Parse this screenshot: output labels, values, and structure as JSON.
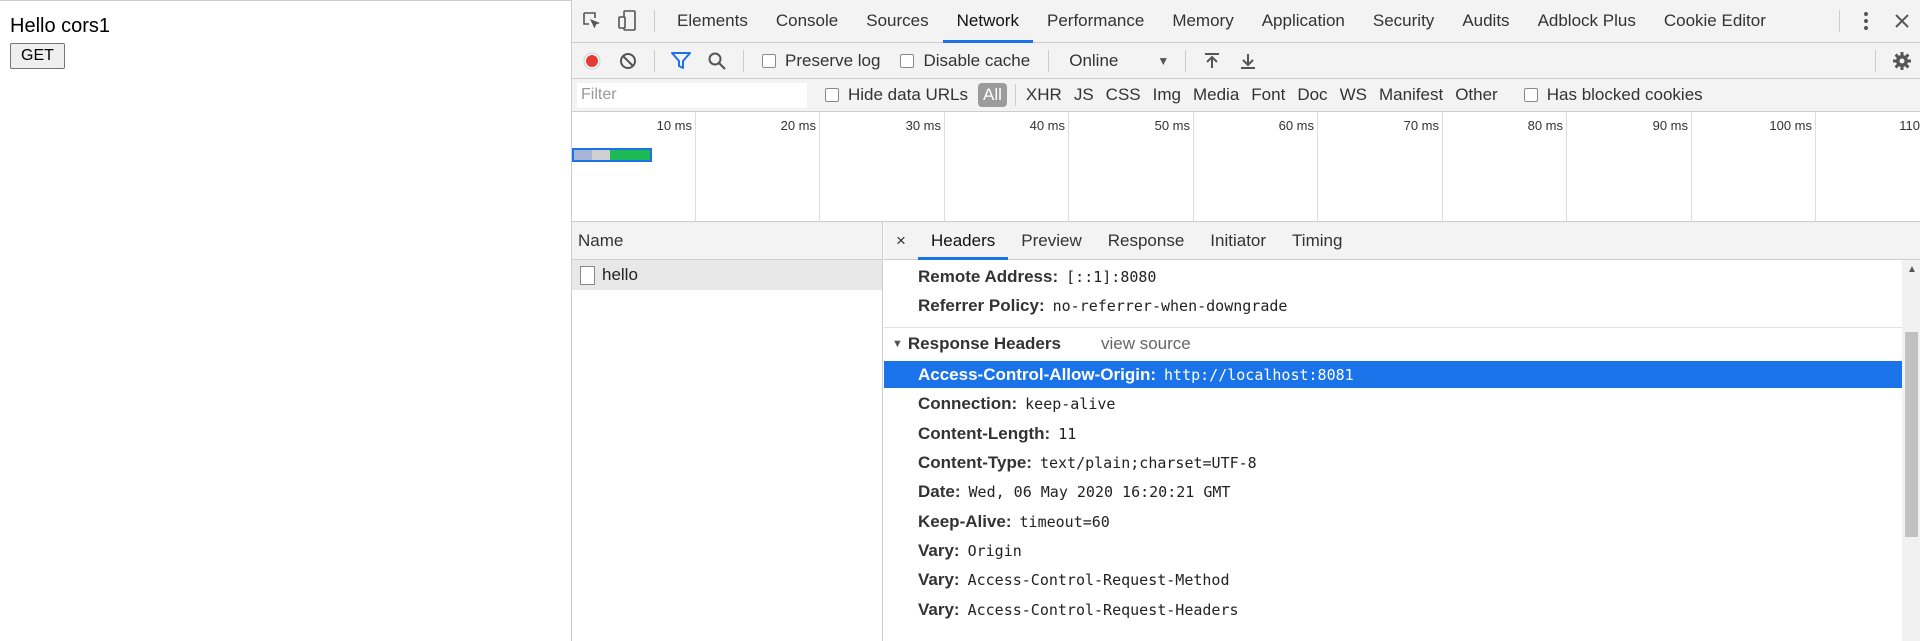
{
  "page": {
    "heading": "Hello cors1",
    "get_button": "GET"
  },
  "devtools": {
    "tabs": [
      "Elements",
      "Console",
      "Sources",
      "Network",
      "Performance",
      "Memory",
      "Application",
      "Security",
      "Audits",
      "Adblock Plus",
      "Cookie Editor"
    ],
    "active_tab": "Network",
    "toolbar": {
      "preserve_log": "Preserve log",
      "disable_cache": "Disable cache",
      "throttle": "Online"
    },
    "filter": {
      "placeholder": "Filter",
      "hide_data_urls": "Hide data URLs",
      "types": [
        "All",
        "XHR",
        "JS",
        "CSS",
        "Img",
        "Media",
        "Font",
        "Doc",
        "WS",
        "Manifest",
        "Other"
      ],
      "active_type": "All",
      "has_blocked_cookies": "Has blocked cookies"
    },
    "timeline": {
      "ticks": [
        "10 ms",
        "20 ms",
        "30 ms",
        "40 ms",
        "50 ms",
        "60 ms",
        "70 ms",
        "80 ms",
        "90 ms",
        "100 ms",
        "110"
      ]
    },
    "requests": {
      "column": "Name",
      "items": [
        "hello"
      ]
    },
    "detail": {
      "close": "×",
      "tabs": [
        "Headers",
        "Preview",
        "Response",
        "Initiator",
        "Timing"
      ],
      "active_tab": "Headers",
      "general": [
        {
          "key": "Remote Address:",
          "value": "[::1]:8080"
        },
        {
          "key": "Referrer Policy:",
          "value": "no-referrer-when-downgrade"
        }
      ],
      "response_headers_title": "Response Headers",
      "view_source": "view source",
      "response_headers": [
        {
          "key": "Access-Control-Allow-Origin:",
          "value": "http://localhost:8081"
        },
        {
          "key": "Connection:",
          "value": "keep-alive"
        },
        {
          "key": "Content-Length:",
          "value": "11"
        },
        {
          "key": "Content-Type:",
          "value": "text/plain;charset=UTF-8"
        },
        {
          "key": "Date:",
          "value": "Wed, 06 May 2020 16:20:21 GMT"
        },
        {
          "key": "Keep-Alive:",
          "value": "timeout=60"
        },
        {
          "key": "Vary:",
          "value": "Origin"
        },
        {
          "key": "Vary:",
          "value": "Access-Control-Request-Method"
        },
        {
          "key": "Vary:",
          "value": "Access-Control-Request-Headers"
        }
      ]
    }
  },
  "colors": {
    "accent": "#1a73e8",
    "record": "#e53935",
    "waterfall_green": "#1db954"
  }
}
